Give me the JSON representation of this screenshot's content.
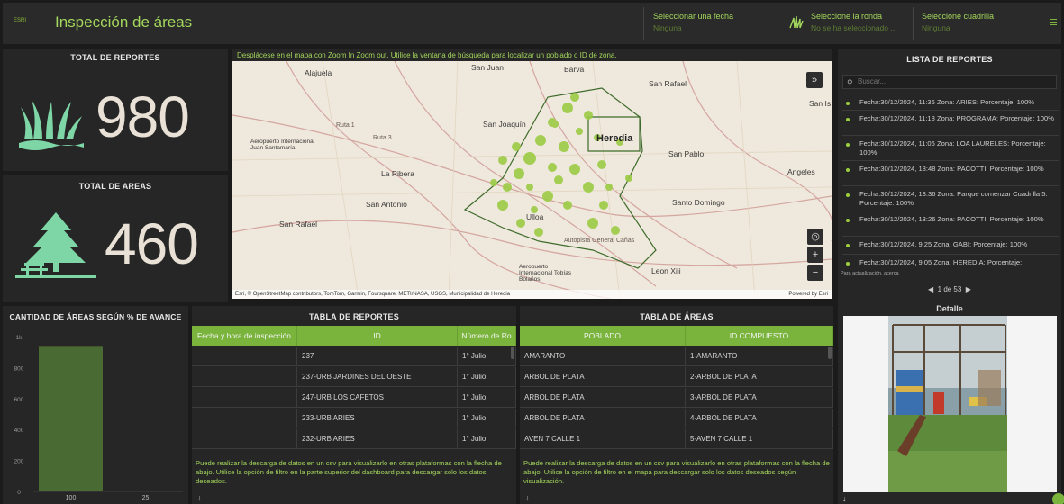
{
  "header": {
    "logo_text": "ESRI",
    "title": "Inspección de áreas",
    "date_label": "Seleccionar una fecha",
    "date_value": "Ninguna",
    "round_label": "Seleccione la ronda",
    "round_value": "No se ha seleccionado ...",
    "grid_label": "Seleccione cuadrilla",
    "grid_value": "Ninguna",
    "colors": {
      "accent": "#a3d65c",
      "bar": "#4a6a34",
      "table_header": "#7ab43c"
    }
  },
  "kpis": {
    "reports_title": "TOTAL DE REPORTES",
    "reports_value": "980",
    "areas_title": "TOTAL DE AREAS",
    "areas_value": "460",
    "reports_icon": "grass-icon",
    "areas_icon": "tree-picnic-icon"
  },
  "map": {
    "hint": "Desplácese en el mapa con Zoom In Zoom out. Utilice la ventana de búsqueda para localizar un poblado o ID de zona.",
    "places": [
      "Alajuela",
      "San Juan",
      "Barva",
      "San Rafael",
      "San Is",
      "San Joaquín",
      "Heredia",
      "San Pablo",
      "Aeropuerto Internacional Juan Santamaría",
      "La Ribera",
      "Angeles",
      "San Antonio",
      "Santo Domingo",
      "San Rafael",
      "Ulloa",
      "Leon Xiii",
      "Aeropuerto Internacional Tobías Bolaños",
      "Ruta 3",
      "Ruta 1",
      "Autopista General Cañas"
    ],
    "attribution": "Esri, © OpenStreetMap contributors, TomTom, Garmin, Foursquare, METI/NASA, USGS, Municipalidad de Heredia",
    "powered": "Powered by Esri"
  },
  "list": {
    "title": "LISTA DE REPORTES",
    "search_placeholder": "Buscar...",
    "items": [
      "Fecha:30/12/2024, 11:36 Zona: ARIES: Porcentaje: 100%",
      "Fecha:30/12/2024, 11:18 Zona: PROGRAMA: Porcentaje: 100%",
      "Fecha:30/12/2024, 11:06 Zona: LOA LAURELES: Porcentaje: 100%",
      "Fecha:30/12/2024, 13:48 Zona: PACOTTI: Porcentaje: 100%",
      "Fecha:30/12/2024, 13:36 Zona: Parque comenzar Cuadrilla 5: Porcentaje: 100%",
      "Fecha:30/12/2024, 13:26 Zona: PACOTTI: Porcentaje: 100%",
      "Fecha:30/12/2024, 9:25 Zona: GABI: Porcentaje: 100%",
      "Fecha:30/12/2024, 9:05 Zona: HEREDIA: Porcentaje:"
    ],
    "footer_note": "Para actualización, acerca",
    "pager": "1 de 53",
    "detail_title": "Detalle"
  },
  "chart_data": {
    "type": "bar",
    "title": "CANTIDAD DE ÁREAS SEGÚN % DE AVANCE",
    "categories": [
      "100",
      "25"
    ],
    "values": [
      940,
      0
    ],
    "yticks": [
      "1k",
      "800",
      "600",
      "400",
      "200",
      "0"
    ],
    "ylim": [
      0,
      1000
    ],
    "grid": false
  },
  "table_reports": {
    "title": "TABLA DE REPORTES",
    "columns": [
      "Fecha y hora de inspección",
      "ID",
      "Número de Ro"
    ],
    "rows": [
      [
        "",
        "237",
        "1° Julio"
      ],
      [
        "",
        "237-URB JARDINES DEL OESTE",
        "1° Julio"
      ],
      [
        "",
        "247-URB LOS CAFETOS",
        "1° Julio"
      ],
      [
        "",
        "233-URB ARIES",
        "1° Julio"
      ],
      [
        "",
        "232-URB ARIES",
        "1° Julio"
      ]
    ],
    "note": "Puede realizar la descarga de datos en un csv para visualizarlo en otras plataformas con la flecha de abajo. Utilice la opción de filtro en la parte superior del dashboard para descargar solo los datos deseados."
  },
  "table_areas": {
    "title": "TABLA DE ÁREAS",
    "columns": [
      "POBLADO",
      "ID COMPUESTO"
    ],
    "rows": [
      [
        "AMARANTO",
        "1-AMARANTO"
      ],
      [
        "ARBOL DE PLATA",
        "2-ARBOL DE PLATA"
      ],
      [
        "ARBOL DE PLATA",
        "3-ARBOL DE PLATA"
      ],
      [
        "ARBOL DE PLATA",
        "4-ARBOL DE PLATA"
      ],
      [
        "AVEN 7 CALLE 1",
        "5-AVEN 7 CALLE 1"
      ]
    ],
    "note": "Puede realizar la descarga de datos en un csv para visualizarlo en otras plataformas con la flecha de abajo. Utilice la opción de filtro en el mapa para descargar solo los datos deseados según visualización."
  }
}
